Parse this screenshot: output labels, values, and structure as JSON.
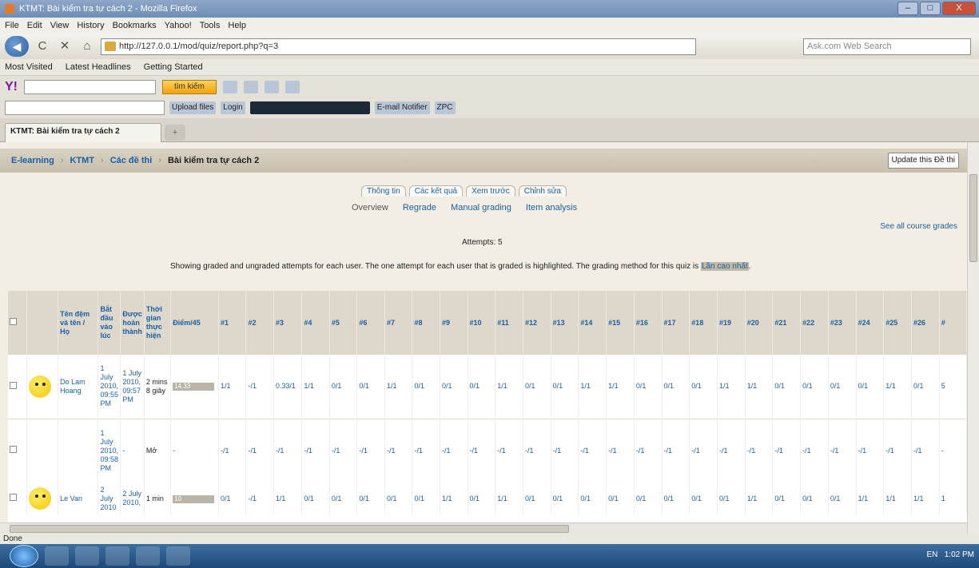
{
  "window": {
    "title": "KTMT: Bài kiểm tra tự cách 2 - Mozilla Firefox",
    "minimize": "–",
    "maximize": "□",
    "close": "X"
  },
  "menu": [
    "File",
    "Edit",
    "View",
    "History",
    "Bookmarks",
    "Yahoo!",
    "Tools",
    "Help"
  ],
  "nav": {
    "back": "◀",
    "reload": "C",
    "stop": "✕",
    "home": "⌂",
    "url": "http://127.0.0.1/mod/quiz/report.php?q=3",
    "search_placeholder": "Ask.com Web Search"
  },
  "bookmarks": [
    "Most Visited",
    "Latest Headlines",
    "Getting Started"
  ],
  "yahoo_toolbar": {
    "logo": "Y!",
    "search_button": "tìm kiếm"
  },
  "toolbar2": {
    "login": "Login",
    "email": "E-mail Notifier",
    "zpc": "ZPC",
    "upload": "Upload files"
  },
  "tab": {
    "title": "KTMT: Bài kiểm tra tự cách 2",
    "new_tab": "+"
  },
  "breadcrumb": [
    {
      "label": "E-learning"
    },
    {
      "label": "KTMT"
    },
    {
      "label": "Các đề thi"
    }
  ],
  "breadcrumb_current": "Bài kiểm tra tự cách 2",
  "update_button": "Update this Đề thi",
  "quiz_tabs": [
    "Thông tin",
    "Các kết quả",
    "Xem trước",
    "Chỉnh sửa"
  ],
  "report_tabs": [
    "Overview",
    "Regrade",
    "Manual grading",
    "Item analysis"
  ],
  "see_all": "See all course grades",
  "attempts": "Attempts: 5",
  "showing": {
    "text": "Showing graded and ungraded attempts for each user. The one attempt for each user that is graded is highlighted. The grading method for this quiz is",
    "method": "Lần cao nhất",
    "dot": "."
  },
  "table": {
    "headers": {
      "name": "Tên đệm và tên / Họ",
      "start": "Bắt đầu vào lúc",
      "done": "Được hoàn thành",
      "time": "Thời gian thực hiện",
      "score": "Điểm/45"
    },
    "questions": [
      "#1",
      "#2",
      "#3",
      "#4",
      "#5",
      "#6",
      "#7",
      "#8",
      "#9",
      "#10",
      "#11",
      "#12",
      "#13",
      "#14",
      "#15",
      "#16",
      "#17",
      "#18",
      "#19",
      "#20",
      "#21",
      "#22",
      "#23",
      "#24",
      "#25",
      "#26",
      "#"
    ],
    "rows": [
      {
        "name": "Do Lam Hoang",
        "start": "1 July 2010, 09:55 PM",
        "done": "1 July 2010, 09:57 PM",
        "time": "2 mins 8 giây",
        "score": "14.33",
        "cells": [
          "1/1",
          "-/1",
          "0.33/1",
          "1/1",
          "0/1",
          "0/1",
          "1/1",
          "0/1",
          "0/1",
          "0/1",
          "1/1",
          "0/1",
          "0/1",
          "1/1",
          "1/1",
          "0/1",
          "0/1",
          "0/1",
          "1/1",
          "1/1",
          "0/1",
          "0/1",
          "0/1",
          "0/1",
          "1/1",
          "0/1",
          "5"
        ]
      },
      {
        "name": "",
        "start": "1 July 2010, 09:58 PM",
        "done": "-",
        "time": "Mở",
        "score": "-",
        "cells": [
          "-/1",
          "-/1",
          "-/1",
          "-/1",
          "-/1",
          "-/1",
          "-/1",
          "-/1",
          "-/1",
          "-/1",
          "-/1",
          "-/1",
          "-/1",
          "-/1",
          "-/1",
          "-/1",
          "-/1",
          "-/1",
          "-/1",
          "-/1",
          "-/1",
          "-/1",
          "-/1",
          "-/1",
          "-/1",
          "-/1",
          "-"
        ]
      },
      {
        "name": "Le Van",
        "start": "2 July 2010",
        "done": "2 July 2010,",
        "time": "1 min",
        "score": "10",
        "cells": [
          "0/1",
          "-/1",
          "1/1",
          "0/1",
          "0/1",
          "0/1",
          "0/1",
          "0/1",
          "1/1",
          "0/1",
          "1/1",
          "0/1",
          "0/1",
          "0/1",
          "0/1",
          "0/1",
          "0/1",
          "0/1",
          "0/1",
          "1/1",
          "0/1",
          "0/1",
          "0/1",
          "1/1",
          "1/1",
          "1/1",
          "1"
        ]
      }
    ]
  },
  "status": "Done",
  "tray": {
    "lang": "EN",
    "time": "1:02 PM"
  }
}
